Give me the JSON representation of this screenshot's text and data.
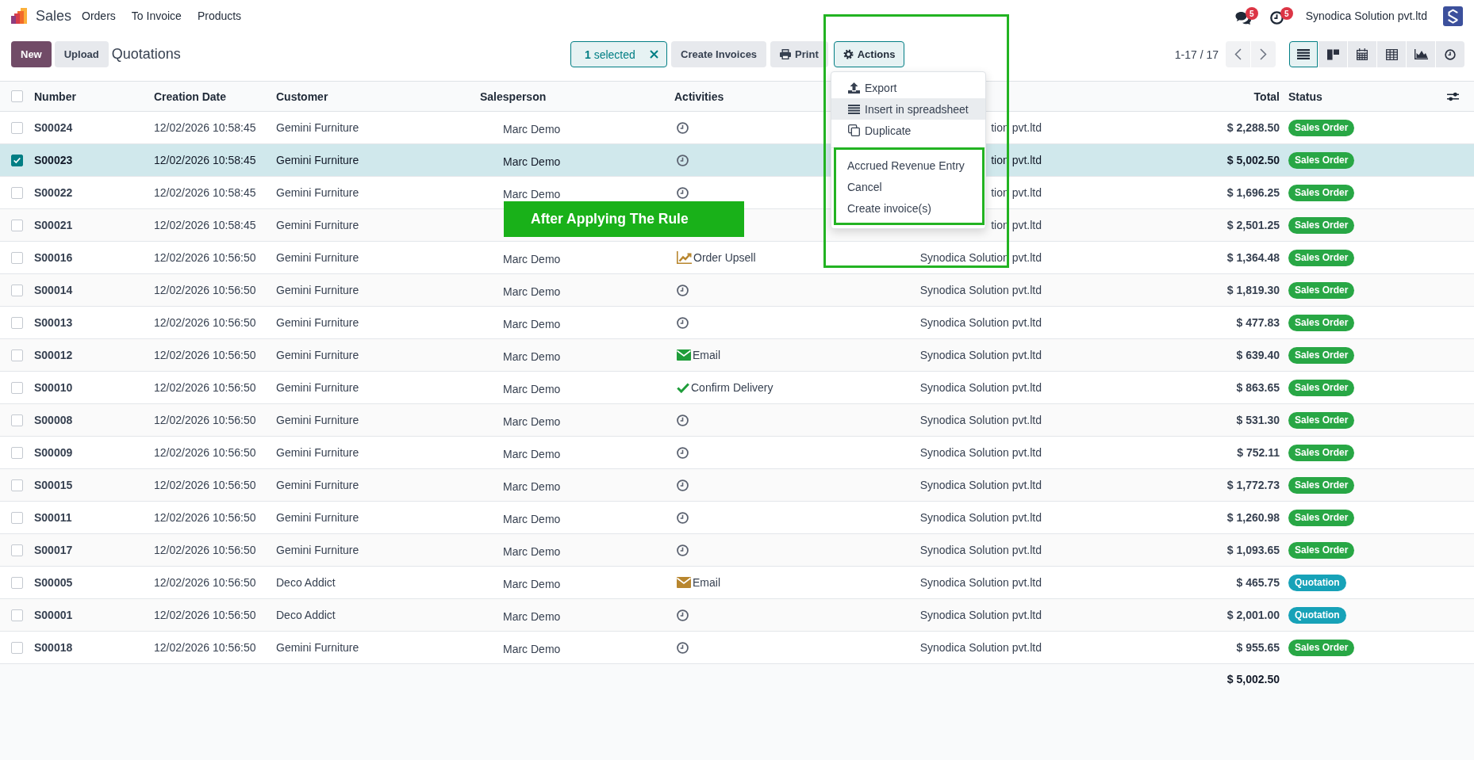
{
  "navbar": {
    "app_name": "Sales",
    "menu": [
      "Orders",
      "To Invoice",
      "Products"
    ],
    "messages_count": "5",
    "activities_count": "5",
    "company": "Synodica Solution pvt.ltd"
  },
  "control_panel": {
    "new_button": "New",
    "upload_button": "Upload",
    "breadcrumb": "Quotations",
    "selection": "**1** selected",
    "buttons": [
      {
        "kind": "plain",
        "label": "Create Invoices"
      },
      {
        "kind": "print",
        "label": "Print"
      }
    ],
    "actions": {
      "label": "Actions",
      "expanded": true,
      "groups": [
        [
          {
            "kind": "export",
            "label": "Export",
            "selected": false
          },
          {
            "kind": "spreadsheet",
            "label": "Insert in spreadsheet",
            "selected": true
          },
          {
            "kind": "duplicate",
            "label": "Duplicate",
            "selected": false
          }
        ],
        [
          {
            "kind": "plain",
            "label": "Accrued Revenue Entry",
            "selected": false
          },
          {
            "kind": "plain",
            "label": "Cancel",
            "selected": false
          },
          {
            "kind": "plain",
            "label": "Create invoice(s)",
            "selected": false
          }
        ]
      ]
    },
    "pager": "1-17 / 17",
    "views": [
      {
        "kind": "list",
        "selected": true
      },
      {
        "kind": "kanban",
        "selected": false
      },
      {
        "kind": "calendar",
        "selected": false
      },
      {
        "kind": "pivot",
        "selected": false
      },
      {
        "kind": "graph",
        "selected": false
      },
      {
        "kind": "activity",
        "selected": false
      }
    ]
  },
  "table": {
    "select_all": false,
    "columns": {
      "number": "Number",
      "creation_date": "Creation Date",
      "customer": "Customer",
      "salesperson": "Salesperson",
      "activities": "Activities",
      "total": "Total",
      "status": "Status"
    },
    "rows": [
      {
        "selected": false,
        "number": "S00024",
        "creation_date": "12/02/2026 10:58:45",
        "customer": "Gemini Furniture",
        "salesperson": "Marc Demo",
        "activity": {
          "kind": "none"
        },
        "column_7": "tion pvt.ltd",
        "total": "$ 2,288.50",
        "status": {
          "label": "Sales Order",
          "color": "#28a745"
        }
      },
      {
        "selected": true,
        "number": "S00023",
        "creation_date": "12/02/2026 10:58:45",
        "customer": "Gemini Furniture",
        "salesperson": "Marc Demo",
        "activity": {
          "kind": "none"
        },
        "column_7": "tion pvt.ltd",
        "total": "$ 5,002.50",
        "status": {
          "label": "Sales Order",
          "color": "#28a745"
        }
      },
      {
        "selected": false,
        "number": "S00022",
        "creation_date": "12/02/2026 10:58:45",
        "customer": "Gemini Furniture",
        "salesperson": "Marc Demo",
        "activity": {
          "kind": "none"
        },
        "column_7": "tion pvt.ltd",
        "total": "$ 1,696.25",
        "status": {
          "label": "Sales Order",
          "color": "#28a745"
        }
      },
      {
        "selected": false,
        "number": "S00021",
        "creation_date": "12/02/2026 10:58:45",
        "customer": "Gemini Furniture",
        "column_7": "tion pvt.ltd",
        "total": "$ 2,501.25",
        "status": {
          "label": "Sales Order",
          "color": "#28a745"
        }
      },
      {
        "selected": false,
        "number": "S00016",
        "creation_date": "12/02/2026 10:56:50",
        "customer": "Gemini Furniture",
        "salesperson": "Marc Demo",
        "activity": {
          "kind": "upsell",
          "label": "Order Upsell",
          "color": "#b8862e"
        },
        "column_7": "Synodica Solution pvt.ltd",
        "total": "$ 1,364.48",
        "status": {
          "label": "Sales Order",
          "color": "#28a745"
        }
      },
      {
        "selected": false,
        "number": "S00014",
        "creation_date": "12/02/2026 10:56:50",
        "customer": "Gemini Furniture",
        "salesperson": "Marc Demo",
        "activity": {
          "kind": "none"
        },
        "column_7": "Synodica Solution pvt.ltd",
        "total": "$ 1,819.30",
        "status": {
          "label": "Sales Order",
          "color": "#28a745"
        }
      },
      {
        "selected": false,
        "number": "S00013",
        "creation_date": "12/02/2026 10:56:50",
        "customer": "Gemini Furniture",
        "salesperson": "Marc Demo",
        "activity": {
          "kind": "none"
        },
        "column_7": "Synodica Solution pvt.ltd",
        "total": "$ 477.83",
        "status": {
          "label": "Sales Order",
          "color": "#28a745"
        }
      },
      {
        "selected": false,
        "number": "S00012",
        "creation_date": "12/02/2026 10:56:50",
        "customer": "Gemini Furniture",
        "salesperson": "Marc Demo",
        "activity": {
          "kind": "email",
          "label": "Email",
          "color": "#1f9d3a"
        },
        "column_7": "Synodica Solution pvt.ltd",
        "total": "$ 639.40",
        "status": {
          "label": "Sales Order",
          "color": "#28a745"
        }
      },
      {
        "selected": false,
        "number": "S00010",
        "creation_date": "12/02/2026 10:56:50",
        "customer": "Gemini Furniture",
        "salesperson": "Marc Demo",
        "activity": {
          "kind": "todo",
          "label": "Confirm Delivery",
          "color": "#1f9d3a"
        },
        "column_7": "Synodica Solution pvt.ltd",
        "total": "$ 863.65",
        "status": {
          "label": "Sales Order",
          "color": "#28a745"
        }
      },
      {
        "selected": false,
        "number": "S00008",
        "creation_date": "12/02/2026 10:56:50",
        "customer": "Gemini Furniture",
        "salesperson": "Marc Demo",
        "activity": {
          "kind": "none"
        },
        "column_7": "Synodica Solution pvt.ltd",
        "total": "$ 531.30",
        "status": {
          "label": "Sales Order",
          "color": "#28a745"
        }
      },
      {
        "selected": false,
        "number": "S00009",
        "creation_date": "12/02/2026 10:56:50",
        "customer": "Gemini Furniture",
        "salesperson": "Marc Demo",
        "activity": {
          "kind": "none"
        },
        "column_7": "Synodica Solution pvt.ltd",
        "total": "$ 752.11",
        "status": {
          "label": "Sales Order",
          "color": "#28a745"
        }
      },
      {
        "selected": false,
        "number": "S00015",
        "creation_date": "12/02/2026 10:56:50",
        "customer": "Gemini Furniture",
        "salesperson": "Marc Demo",
        "activity": {
          "kind": "none"
        },
        "column_7": "Synodica Solution pvt.ltd",
        "total": "$ 1,772.73",
        "status": {
          "label": "Sales Order",
          "color": "#28a745"
        }
      },
      {
        "selected": false,
        "number": "S00011",
        "creation_date": "12/02/2026 10:56:50",
        "customer": "Gemini Furniture",
        "salesperson": "Marc Demo",
        "activity": {
          "kind": "none"
        },
        "column_7": "Synodica Solution pvt.ltd",
        "total": "$ 1,260.98",
        "status": {
          "label": "Sales Order",
          "color": "#28a745"
        }
      },
      {
        "selected": false,
        "number": "S00017",
        "creation_date": "12/02/2026 10:56:50",
        "customer": "Gemini Furniture",
        "salesperson": "Marc Demo",
        "activity": {
          "kind": "none"
        },
        "column_7": "Synodica Solution pvt.ltd",
        "total": "$ 1,093.65",
        "status": {
          "label": "Sales Order",
          "color": "#28a745"
        }
      },
      {
        "selected": false,
        "number": "S00005",
        "creation_date": "12/02/2026 10:56:50",
        "customer": "Deco Addict",
        "salesperson": "Marc Demo",
        "activity": {
          "kind": "email",
          "label": "Email",
          "color": "#b8862e"
        },
        "column_7": "Synodica Solution pvt.ltd",
        "total": "$ 465.75",
        "status": {
          "label": "Quotation",
          "color": "#17a2b8"
        }
      },
      {
        "selected": false,
        "number": "S00001",
        "creation_date": "12/02/2026 10:56:50",
        "customer": "Deco Addict",
        "salesperson": "Marc Demo",
        "activity": {
          "kind": "none"
        },
        "column_7": "Synodica Solution pvt.ltd",
        "total": "$ 2,001.00",
        "status": {
          "label": "Quotation",
          "color": "#17a2b8"
        }
      },
      {
        "selected": false,
        "number": "S00018",
        "creation_date": "12/02/2026 10:56:50",
        "customer": "Gemini Furniture",
        "salesperson": "Marc Demo",
        "activity": {
          "kind": "none"
        },
        "column_7": "Synodica Solution pvt.ltd",
        "total": "$ 955.65",
        "status": {
          "label": "Sales Order",
          "color": "#28a745"
        }
      }
    ],
    "footer_total": "$ 5,002.50"
  },
  "annotation": {
    "banner": "After Applying The Rule"
  }
}
